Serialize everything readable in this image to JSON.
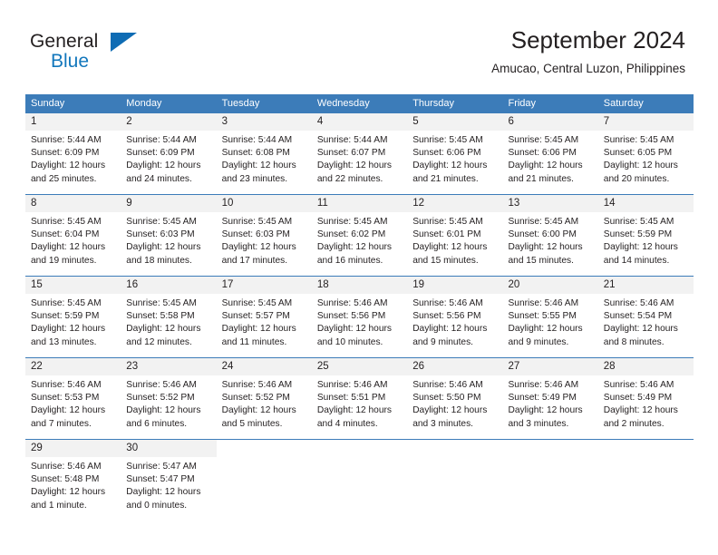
{
  "brand": {
    "name_primary": "General",
    "name_secondary": "Blue",
    "triangle_icon": "triangle-icon",
    "accent_color": "#0f6cb4"
  },
  "header": {
    "title": "September 2024",
    "subtitle": "Amucao, Central Luzon, Philippines"
  },
  "theme": {
    "header_bg": "#3c7cb9",
    "daynum_bg": "#f2f2f2",
    "text_color": "#231f20"
  },
  "weekday_headers": [
    "Sunday",
    "Monday",
    "Tuesday",
    "Wednesday",
    "Thursday",
    "Friday",
    "Saturday"
  ],
  "weeks": [
    [
      {
        "day": "1",
        "sunrise": "Sunrise: 5:44 AM",
        "sunset": "Sunset: 6:09 PM",
        "daylight_line1": "Daylight: 12 hours",
        "daylight_line2": "and 25 minutes."
      },
      {
        "day": "2",
        "sunrise": "Sunrise: 5:44 AM",
        "sunset": "Sunset: 6:09 PM",
        "daylight_line1": "Daylight: 12 hours",
        "daylight_line2": "and 24 minutes."
      },
      {
        "day": "3",
        "sunrise": "Sunrise: 5:44 AM",
        "sunset": "Sunset: 6:08 PM",
        "daylight_line1": "Daylight: 12 hours",
        "daylight_line2": "and 23 minutes."
      },
      {
        "day": "4",
        "sunrise": "Sunrise: 5:44 AM",
        "sunset": "Sunset: 6:07 PM",
        "daylight_line1": "Daylight: 12 hours",
        "daylight_line2": "and 22 minutes."
      },
      {
        "day": "5",
        "sunrise": "Sunrise: 5:45 AM",
        "sunset": "Sunset: 6:06 PM",
        "daylight_line1": "Daylight: 12 hours",
        "daylight_line2": "and 21 minutes."
      },
      {
        "day": "6",
        "sunrise": "Sunrise: 5:45 AM",
        "sunset": "Sunset: 6:06 PM",
        "daylight_line1": "Daylight: 12 hours",
        "daylight_line2": "and 21 minutes."
      },
      {
        "day": "7",
        "sunrise": "Sunrise: 5:45 AM",
        "sunset": "Sunset: 6:05 PM",
        "daylight_line1": "Daylight: 12 hours",
        "daylight_line2": "and 20 minutes."
      }
    ],
    [
      {
        "day": "8",
        "sunrise": "Sunrise: 5:45 AM",
        "sunset": "Sunset: 6:04 PM",
        "daylight_line1": "Daylight: 12 hours",
        "daylight_line2": "and 19 minutes."
      },
      {
        "day": "9",
        "sunrise": "Sunrise: 5:45 AM",
        "sunset": "Sunset: 6:03 PM",
        "daylight_line1": "Daylight: 12 hours",
        "daylight_line2": "and 18 minutes."
      },
      {
        "day": "10",
        "sunrise": "Sunrise: 5:45 AM",
        "sunset": "Sunset: 6:03 PM",
        "daylight_line1": "Daylight: 12 hours",
        "daylight_line2": "and 17 minutes."
      },
      {
        "day": "11",
        "sunrise": "Sunrise: 5:45 AM",
        "sunset": "Sunset: 6:02 PM",
        "daylight_line1": "Daylight: 12 hours",
        "daylight_line2": "and 16 minutes."
      },
      {
        "day": "12",
        "sunrise": "Sunrise: 5:45 AM",
        "sunset": "Sunset: 6:01 PM",
        "daylight_line1": "Daylight: 12 hours",
        "daylight_line2": "and 15 minutes."
      },
      {
        "day": "13",
        "sunrise": "Sunrise: 5:45 AM",
        "sunset": "Sunset: 6:00 PM",
        "daylight_line1": "Daylight: 12 hours",
        "daylight_line2": "and 15 minutes."
      },
      {
        "day": "14",
        "sunrise": "Sunrise: 5:45 AM",
        "sunset": "Sunset: 5:59 PM",
        "daylight_line1": "Daylight: 12 hours",
        "daylight_line2": "and 14 minutes."
      }
    ],
    [
      {
        "day": "15",
        "sunrise": "Sunrise: 5:45 AM",
        "sunset": "Sunset: 5:59 PM",
        "daylight_line1": "Daylight: 12 hours",
        "daylight_line2": "and 13 minutes."
      },
      {
        "day": "16",
        "sunrise": "Sunrise: 5:45 AM",
        "sunset": "Sunset: 5:58 PM",
        "daylight_line1": "Daylight: 12 hours",
        "daylight_line2": "and 12 minutes."
      },
      {
        "day": "17",
        "sunrise": "Sunrise: 5:45 AM",
        "sunset": "Sunset: 5:57 PM",
        "daylight_line1": "Daylight: 12 hours",
        "daylight_line2": "and 11 minutes."
      },
      {
        "day": "18",
        "sunrise": "Sunrise: 5:46 AM",
        "sunset": "Sunset: 5:56 PM",
        "daylight_line1": "Daylight: 12 hours",
        "daylight_line2": "and 10 minutes."
      },
      {
        "day": "19",
        "sunrise": "Sunrise: 5:46 AM",
        "sunset": "Sunset: 5:56 PM",
        "daylight_line1": "Daylight: 12 hours",
        "daylight_line2": "and 9 minutes."
      },
      {
        "day": "20",
        "sunrise": "Sunrise: 5:46 AM",
        "sunset": "Sunset: 5:55 PM",
        "daylight_line1": "Daylight: 12 hours",
        "daylight_line2": "and 9 minutes."
      },
      {
        "day": "21",
        "sunrise": "Sunrise: 5:46 AM",
        "sunset": "Sunset: 5:54 PM",
        "daylight_line1": "Daylight: 12 hours",
        "daylight_line2": "and 8 minutes."
      }
    ],
    [
      {
        "day": "22",
        "sunrise": "Sunrise: 5:46 AM",
        "sunset": "Sunset: 5:53 PM",
        "daylight_line1": "Daylight: 12 hours",
        "daylight_line2": "and 7 minutes."
      },
      {
        "day": "23",
        "sunrise": "Sunrise: 5:46 AM",
        "sunset": "Sunset: 5:52 PM",
        "daylight_line1": "Daylight: 12 hours",
        "daylight_line2": "and 6 minutes."
      },
      {
        "day": "24",
        "sunrise": "Sunrise: 5:46 AM",
        "sunset": "Sunset: 5:52 PM",
        "daylight_line1": "Daylight: 12 hours",
        "daylight_line2": "and 5 minutes."
      },
      {
        "day": "25",
        "sunrise": "Sunrise: 5:46 AM",
        "sunset": "Sunset: 5:51 PM",
        "daylight_line1": "Daylight: 12 hours",
        "daylight_line2": "and 4 minutes."
      },
      {
        "day": "26",
        "sunrise": "Sunrise: 5:46 AM",
        "sunset": "Sunset: 5:50 PM",
        "daylight_line1": "Daylight: 12 hours",
        "daylight_line2": "and 3 minutes."
      },
      {
        "day": "27",
        "sunrise": "Sunrise: 5:46 AM",
        "sunset": "Sunset: 5:49 PM",
        "daylight_line1": "Daylight: 12 hours",
        "daylight_line2": "and 3 minutes."
      },
      {
        "day": "28",
        "sunrise": "Sunrise: 5:46 AM",
        "sunset": "Sunset: 5:49 PM",
        "daylight_line1": "Daylight: 12 hours",
        "daylight_line2": "and 2 minutes."
      }
    ],
    [
      {
        "day": "29",
        "sunrise": "Sunrise: 5:46 AM",
        "sunset": "Sunset: 5:48 PM",
        "daylight_line1": "Daylight: 12 hours",
        "daylight_line2": "and 1 minute."
      },
      {
        "day": "30",
        "sunrise": "Sunrise: 5:47 AM",
        "sunset": "Sunset: 5:47 PM",
        "daylight_line1": "Daylight: 12 hours",
        "daylight_line2": "and 0 minutes."
      },
      {
        "day": "",
        "sunrise": "",
        "sunset": "",
        "daylight_line1": "",
        "daylight_line2": ""
      },
      {
        "day": "",
        "sunrise": "",
        "sunset": "",
        "daylight_line1": "",
        "daylight_line2": ""
      },
      {
        "day": "",
        "sunrise": "",
        "sunset": "",
        "daylight_line1": "",
        "daylight_line2": ""
      },
      {
        "day": "",
        "sunrise": "",
        "sunset": "",
        "daylight_line1": "",
        "daylight_line2": ""
      },
      {
        "day": "",
        "sunrise": "",
        "sunset": "",
        "daylight_line1": "",
        "daylight_line2": ""
      }
    ]
  ]
}
